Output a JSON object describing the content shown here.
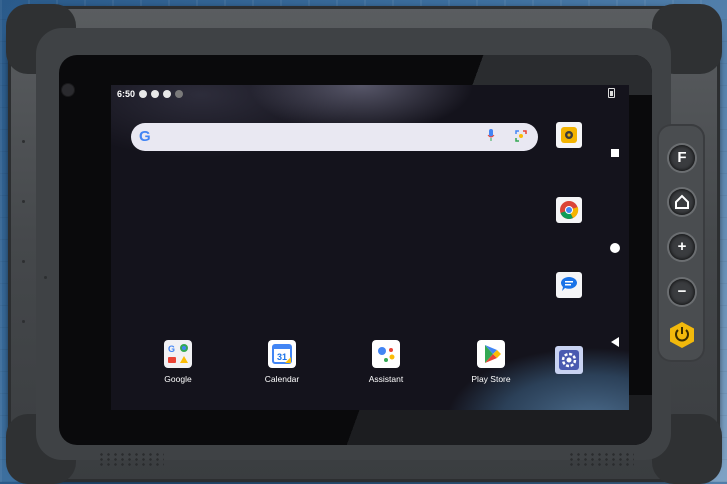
{
  "status_bar": {
    "time": "6:50",
    "icons": [
      "gear-icon",
      "face-icon",
      "shield-icon",
      "wifi-icon"
    ]
  },
  "search": {
    "logo": "G",
    "placeholder": ""
  },
  "home_apps": [
    {
      "label": "Google",
      "icon": "google-folder-icon"
    },
    {
      "label": "Calendar",
      "icon": "calendar-icon",
      "badge": "31"
    },
    {
      "label": "Assistant",
      "icon": "assistant-icon"
    },
    {
      "label": "Play Store",
      "icon": "play-store-icon"
    }
  ],
  "right_column_apps": [
    "camera-icon",
    "chrome-icon",
    "messages-icon",
    "settings-icon"
  ],
  "nav_buttons": [
    "recents-button",
    "home-button",
    "back-button"
  ],
  "hardware_buttons": {
    "f_key": "F",
    "home": "home",
    "volume_up": "+",
    "volume_down": "−",
    "power": "power"
  },
  "colors": {
    "power_button": "#f2b90c",
    "search_bar": "#e9e8f2",
    "screen_bg": "#14131c"
  }
}
